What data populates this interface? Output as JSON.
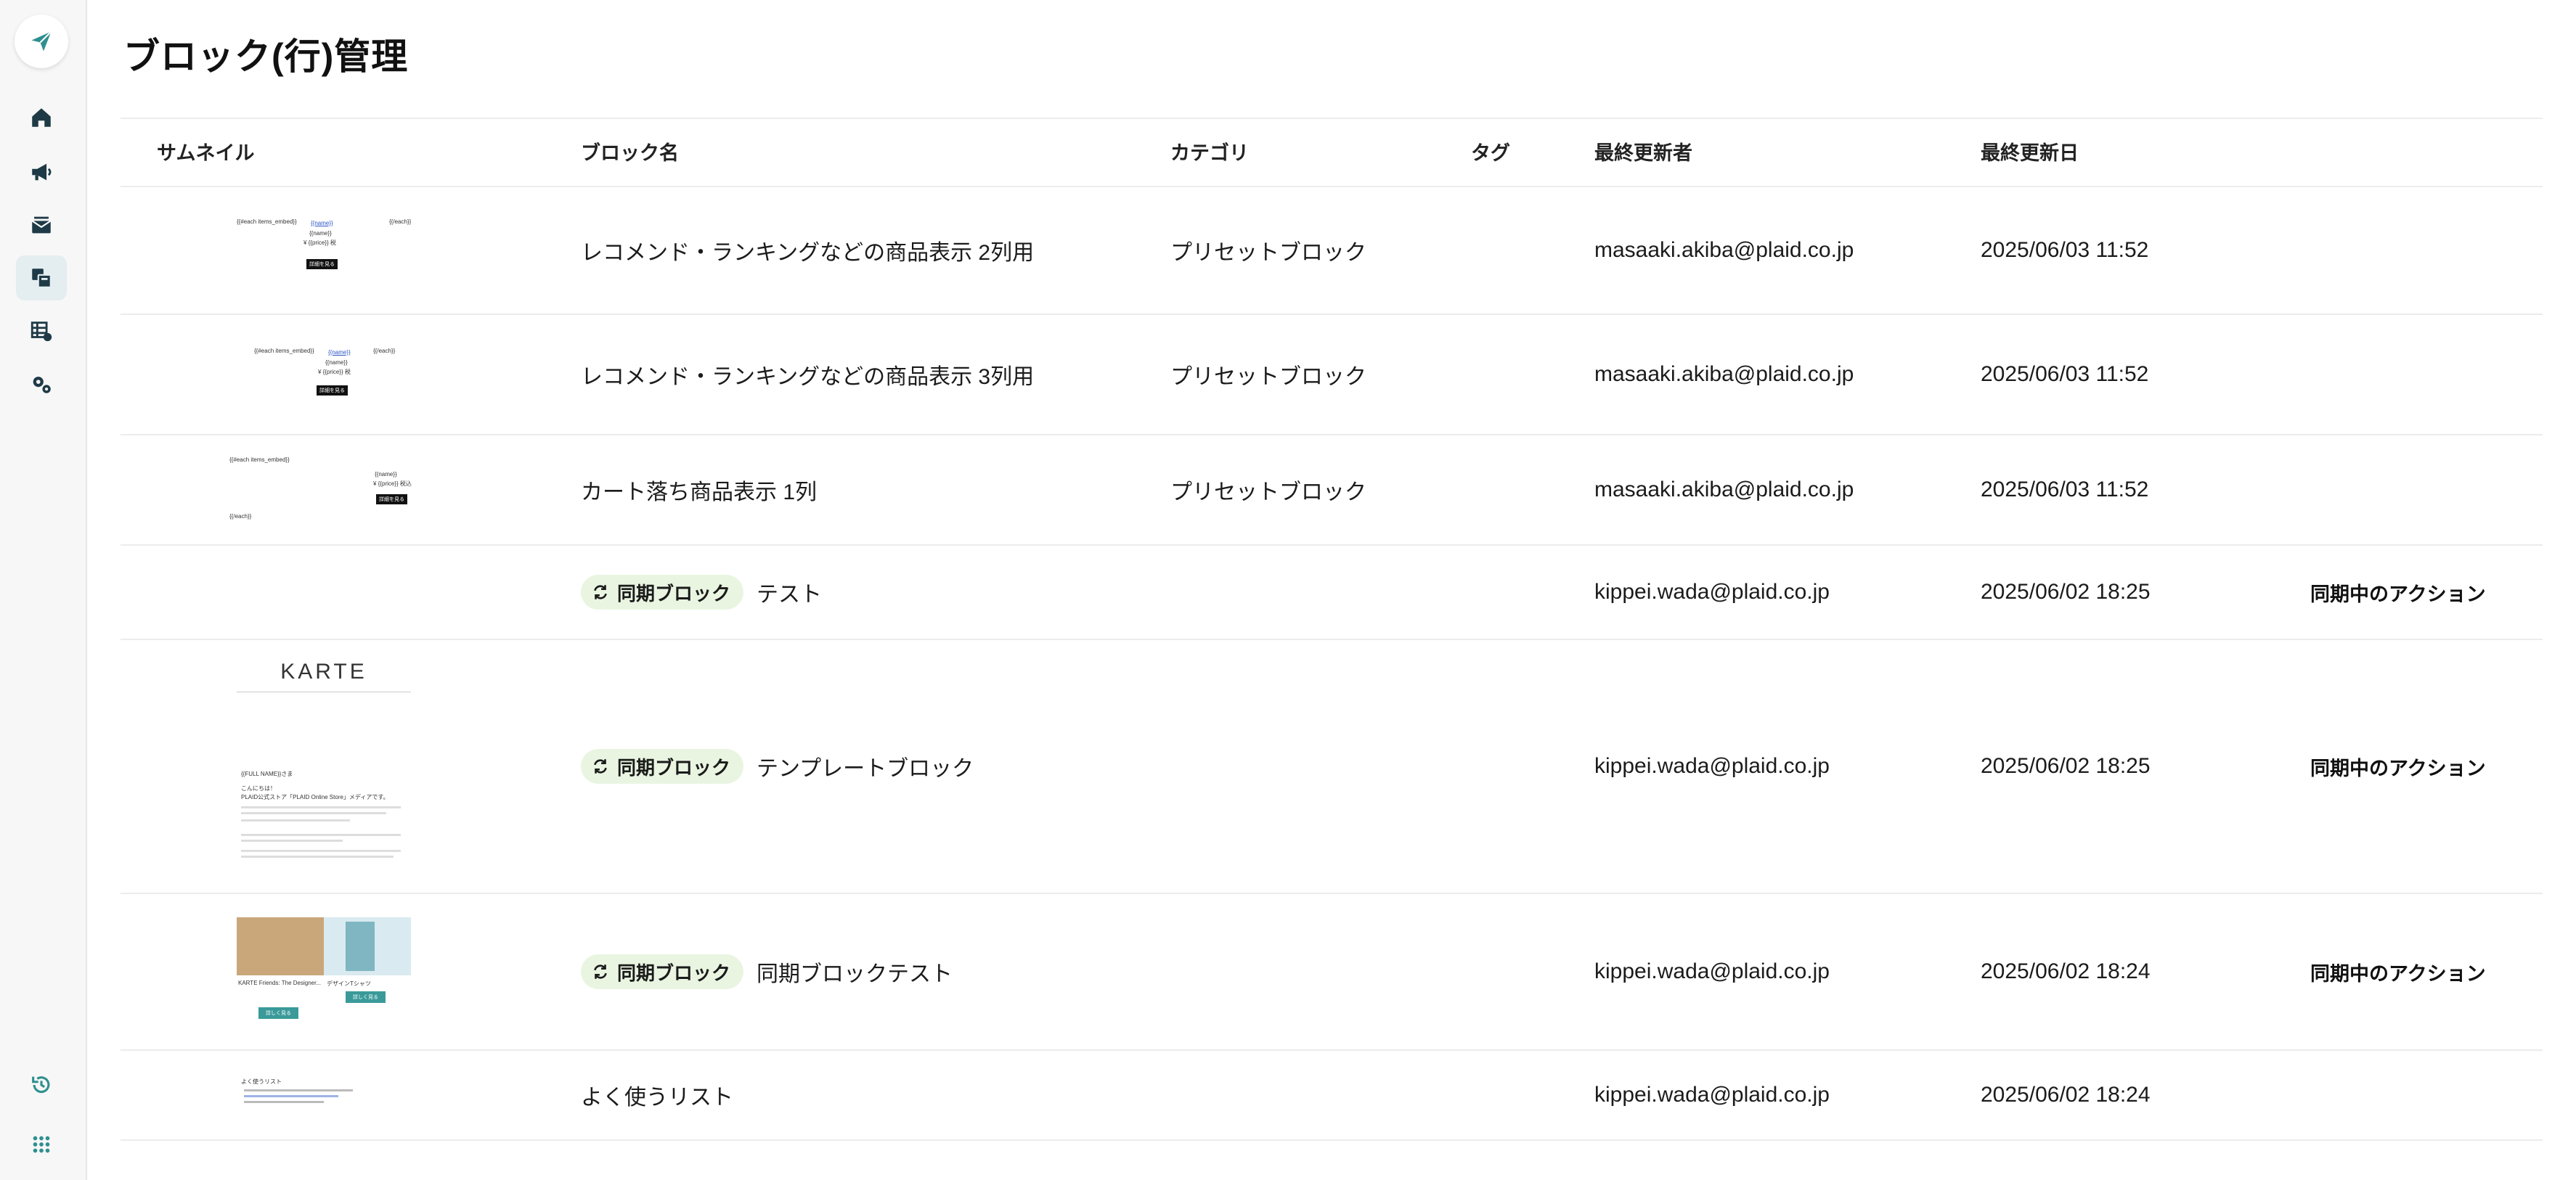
{
  "page": {
    "title": "ブロック(行)管理"
  },
  "sidebar": {
    "logo_icon": "paper-plane-icon",
    "items": [
      {
        "icon": "home-icon"
      },
      {
        "icon": "megaphone-icon"
      },
      {
        "icon": "mail-stack-icon"
      },
      {
        "icon": "blocks-icon",
        "active": true
      },
      {
        "icon": "table-settings-icon"
      },
      {
        "icon": "gears-icon"
      }
    ],
    "bottom_items": [
      {
        "icon": "history-icon"
      },
      {
        "icon": "app-grid-icon"
      }
    ]
  },
  "table": {
    "headers": {
      "thumbnail": "サムネイル",
      "name": "ブロック名",
      "category": "カテゴリ",
      "tag": "タグ",
      "updated_by": "最終更新者",
      "updated_at": "最終更新日"
    },
    "sync_badge_label": "同期ブロック",
    "rows": [
      {
        "name": "レコメンド・ランキングなどの商品表示 2列用",
        "category": "プリセットブロック",
        "tag": "",
        "updated_by": "masaaki.akiba@plaid.co.jp",
        "updated_at": "2025/06/03 11:52",
        "synced": false,
        "sync_action": ""
      },
      {
        "name": "レコメンド・ランキングなどの商品表示 3列用",
        "category": "プリセットブロック",
        "tag": "",
        "updated_by": "masaaki.akiba@plaid.co.jp",
        "updated_at": "2025/06/03 11:52",
        "synced": false,
        "sync_action": ""
      },
      {
        "name": "カート落ち商品表示 1列",
        "category": "プリセットブロック",
        "tag": "",
        "updated_by": "masaaki.akiba@plaid.co.jp",
        "updated_at": "2025/06/03 11:52",
        "synced": false,
        "sync_action": ""
      },
      {
        "name": "テスト",
        "category": "",
        "tag": "",
        "updated_by": "kippei.wada@plaid.co.jp",
        "updated_at": "2025/06/02 18:25",
        "synced": true,
        "sync_action": "同期中のアクション"
      },
      {
        "name": "テンプレートブロック",
        "category": "",
        "tag": "",
        "updated_by": "kippei.wada@plaid.co.jp",
        "updated_at": "2025/06/02 18:25",
        "synced": true,
        "sync_action": "同期中のアクション"
      },
      {
        "name": "同期ブロックテスト",
        "category": "",
        "tag": "",
        "updated_by": "kippei.wada@plaid.co.jp",
        "updated_at": "2025/06/02 18:24",
        "synced": true,
        "sync_action": "同期中のアクション"
      },
      {
        "name": "よく使うリスト",
        "category": "",
        "tag": "",
        "updated_by": "kippei.wada@plaid.co.jp",
        "updated_at": "2025/06/02 18:24",
        "synced": false,
        "sync_action": ""
      }
    ]
  },
  "thumbnails": {
    "t1": {
      "each": "{{#each items_embed}}",
      "name": "{{name}}",
      "price": "¥ {{price}} 税",
      "button": "詳細を見る",
      "end": "{{/each}}"
    },
    "t2": {
      "each": "{{#each items_embed}}",
      "name": "{{name}}",
      "price": "¥ {{price}} 税",
      "button": "詳細を見る",
      "end": "{{/each}}"
    },
    "t3": {
      "each": "{{#each items_embed}}",
      "name": "{{name}}",
      "price": "¥ {{price}} 税込",
      "button": "詳細を見る",
      "end": "{{/each}}"
    },
    "t5": {
      "logo": "KARTE",
      "greeting": "{{FULL NAME}}さま",
      "line1": "こんにちは！",
      "line2": "PLAID公式ストア「PLAID Online Store」メディアです。"
    },
    "t6": {
      "caption1": "KARTE Friends: The Designer...",
      "caption2": "デザインTシャツ",
      "button": "詳しく見る"
    },
    "t7": {
      "title": "よく使うリスト"
    }
  },
  "colors": {
    "accent": "#2f8f8f",
    "badge_bg": "#e9f5e1",
    "active_nav": "#e4edf0"
  }
}
